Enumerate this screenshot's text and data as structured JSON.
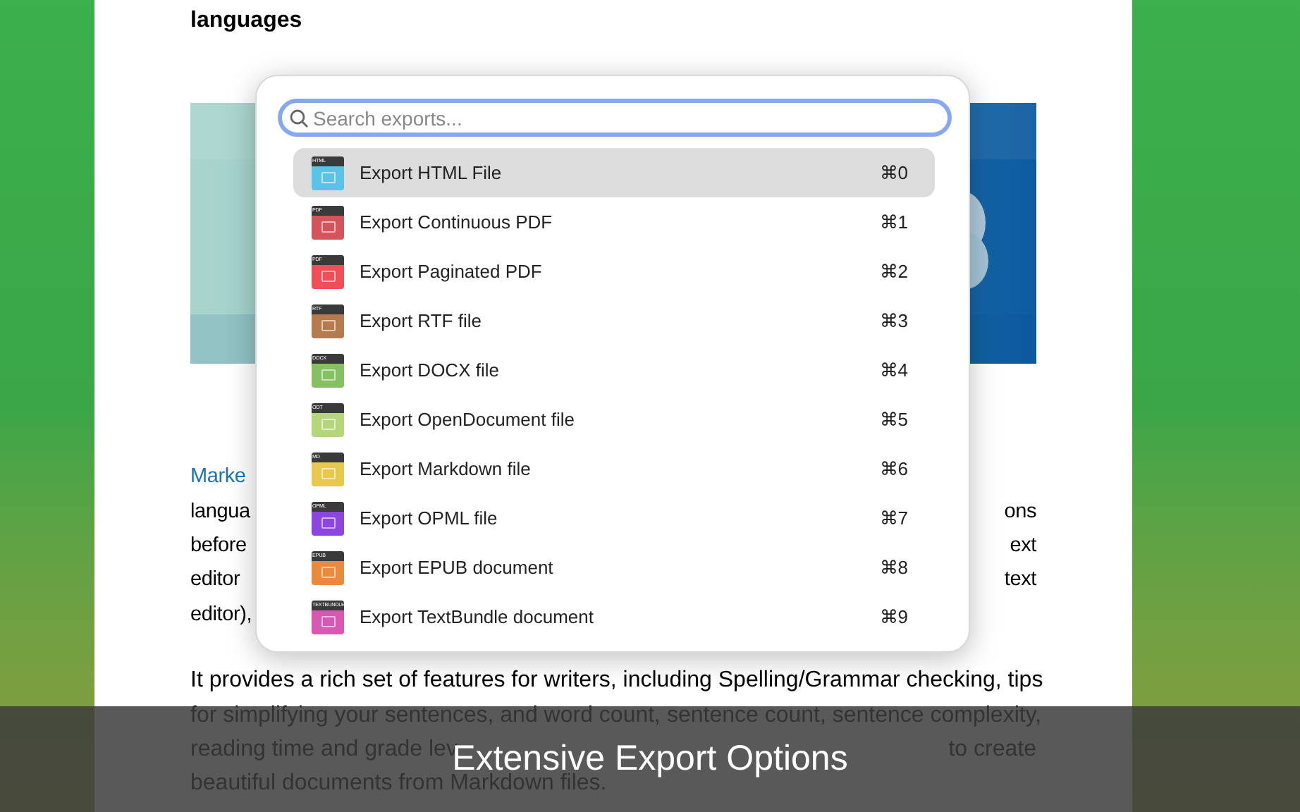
{
  "document": {
    "heading": "languages",
    "paragraph_1_lines": [
      {
        "link": "Marke"
      },
      {
        "left": "langua",
        "right": "ons"
      },
      {
        "left": "before",
        "right": "ext"
      },
      {
        "left": "editor",
        "right": "text"
      },
      {
        "left": "editor),"
      }
    ],
    "paragraph_2_lines": [
      {
        "left": "It provides a rich set of features for writers, including Spelling/Grammar checking, tips"
      },
      {
        "left": "for simplifying your sentences, and word count, sentence count, sentence complexity,"
      },
      {
        "left": "reading time and grade lev",
        "right": "to create"
      },
      {
        "left": "beautiful documents from Markdown files."
      }
    ]
  },
  "export_popup": {
    "search": {
      "placeholder": "Search exports..."
    },
    "items": [
      {
        "label": "Export HTML File",
        "shortcut": "⌘0",
        "tag": "HTML",
        "color": "#5bc4e6",
        "selected": true
      },
      {
        "label": "Export Continuous PDF",
        "shortcut": "⌘1",
        "tag": "PDF",
        "color": "#d4545c",
        "selected": false
      },
      {
        "label": "Export Paginated PDF",
        "shortcut": "⌘2",
        "tag": "PDF",
        "color": "#f04e58",
        "selected": false
      },
      {
        "label": "Export RTF file",
        "shortcut": "⌘3",
        "tag": "RTF",
        "color": "#b57a4e",
        "selected": false
      },
      {
        "label": "Export DOCX file",
        "shortcut": "⌘4",
        "tag": "DOCX",
        "color": "#86c062",
        "selected": false
      },
      {
        "label": "Export OpenDocument file",
        "shortcut": "⌘5",
        "tag": "ODT",
        "color": "#b6d67c",
        "selected": false
      },
      {
        "label": "Export Markdown file",
        "shortcut": "⌘6",
        "tag": "MD",
        "color": "#e6c84c",
        "selected": false
      },
      {
        "label": "Export OPML file",
        "shortcut": "⌘7",
        "tag": "OPML",
        "color": "#8d45e0",
        "selected": false
      },
      {
        "label": "Export EPUB document",
        "shortcut": "⌘8",
        "tag": "EPUB",
        "color": "#e98a3c",
        "selected": false
      },
      {
        "label": "Export TextBundle document",
        "shortcut": "⌘9",
        "tag": "TEXTBUNDLE",
        "color": "#d858b2",
        "selected": false
      }
    ]
  },
  "caption": "Extensive Export Options"
}
